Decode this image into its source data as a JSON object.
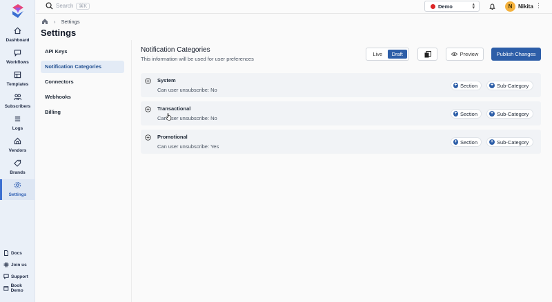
{
  "sidebar": {
    "items": [
      {
        "label": "Dashboard",
        "icon": "home-icon"
      },
      {
        "label": "Workflows",
        "icon": "chat-icon"
      },
      {
        "label": "Templates",
        "icon": "templates-icon"
      },
      {
        "label": "Subscribers",
        "icon": "users-icon"
      },
      {
        "label": "Logs",
        "icon": "list-icon"
      },
      {
        "label": "Vendors",
        "icon": "vendors-icon"
      },
      {
        "label": "Brands",
        "icon": "tag-icon"
      },
      {
        "label": "Settings",
        "icon": "gear-icon",
        "active": true
      }
    ],
    "footer": [
      {
        "label": "Docs",
        "icon": "doc-icon"
      },
      {
        "label": "Join us",
        "icon": "slack-icon"
      },
      {
        "label": "Support",
        "icon": "chat-icon"
      },
      {
        "label": "Book Demo",
        "icon": "calendar-icon"
      }
    ]
  },
  "topbar": {
    "search_label": "Search",
    "search_shortcut": "⌘K",
    "environment": "Demo",
    "environment_color": "#dc2626",
    "user_initial": "N",
    "user_name": "Nikita"
  },
  "breadcrumb": {
    "current": "Settings"
  },
  "page_title": "Settings",
  "subnav": {
    "items": [
      {
        "label": "API Keys"
      },
      {
        "label": "Notification Categories",
        "active": true
      },
      {
        "label": "Connectors"
      },
      {
        "label": "Webhooks"
      },
      {
        "label": "Billing"
      }
    ]
  },
  "main": {
    "title": "Notification Categories",
    "subtitle": "This information will be used for user preferences",
    "toggle": {
      "live": "Live",
      "draft": "Draft",
      "selected": "Draft"
    },
    "preview_label": "Preview",
    "publish_label": "Publish Changes",
    "section_chip": "Section",
    "subcategory_chip": "Sub-Category",
    "categories": [
      {
        "name": "System",
        "unsubscribe_text": "Can user unsubscribe: No"
      },
      {
        "name": "Transactional",
        "unsubscribe_text": "Can user unsubscribe: No"
      },
      {
        "name": "Promotional",
        "unsubscribe_text": "Can user unsubscribe: Yes"
      }
    ]
  },
  "colors": {
    "accent": "#2d5ea8",
    "sidebar_bg": "#eaf0f8",
    "avatar": "#f4b23e"
  }
}
